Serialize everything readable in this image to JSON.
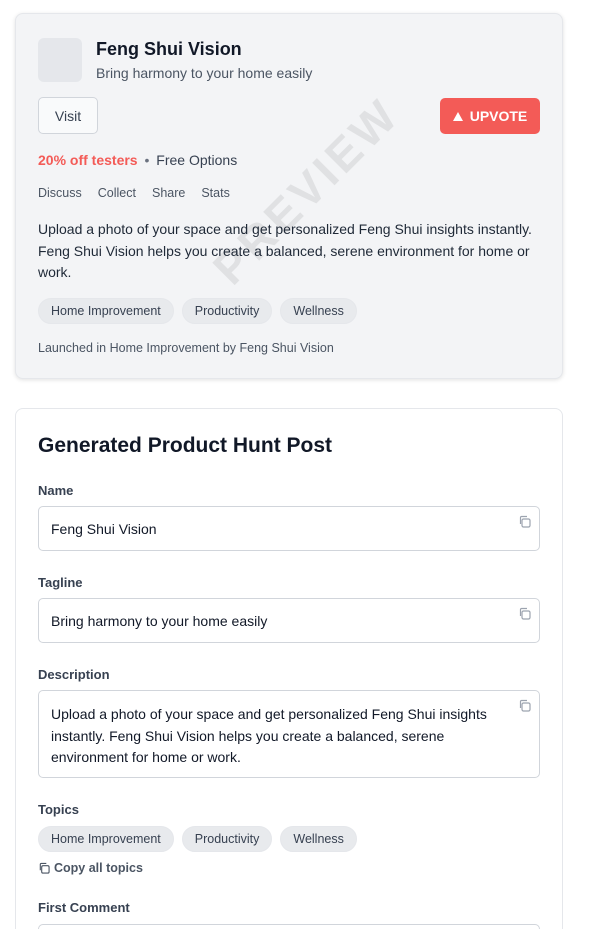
{
  "preview": {
    "watermark": "PREVIEW",
    "name": "Feng Shui Vision",
    "tagline": "Bring harmony to your home easily",
    "visit_label": "Visit",
    "upvote_label": "UPVOTE",
    "offer": "20% off testers",
    "separator": "•",
    "pricing": "Free Options",
    "actions": [
      "Discuss",
      "Collect",
      "Share",
      "Stats"
    ],
    "description": "Upload a photo of your space and get personalized Feng Shui insights instantly. Feng Shui Vision helps you create a balanced, serene environment for home or work.",
    "topics": [
      "Home Improvement",
      "Productivity",
      "Wellness"
    ],
    "launched": "Launched in Home Improvement by Feng Shui Vision"
  },
  "generated": {
    "title": "Generated Product Hunt Post",
    "name_label": "Name",
    "name_value": "Feng Shui Vision",
    "tagline_label": "Tagline",
    "tagline_value": "Bring harmony to your home easily",
    "description_label": "Description",
    "description_value": "Upload a photo of your space and get personalized Feng Shui insights instantly. Feng Shui Vision helps you create a balanced, serene environment for home or work.",
    "topics_label": "Topics",
    "topics": [
      "Home Improvement",
      "Productivity",
      "Wellness"
    ],
    "copy_topics_label": "Copy all topics",
    "first_comment_label": "First Comment"
  },
  "colors": {
    "accent": "#f35b57",
    "card_bg": "#f3f4f6",
    "chip_bg": "#e8eaed"
  },
  "icons": {
    "copy": "copy-icon",
    "upvote": "triangle-up-icon"
  }
}
